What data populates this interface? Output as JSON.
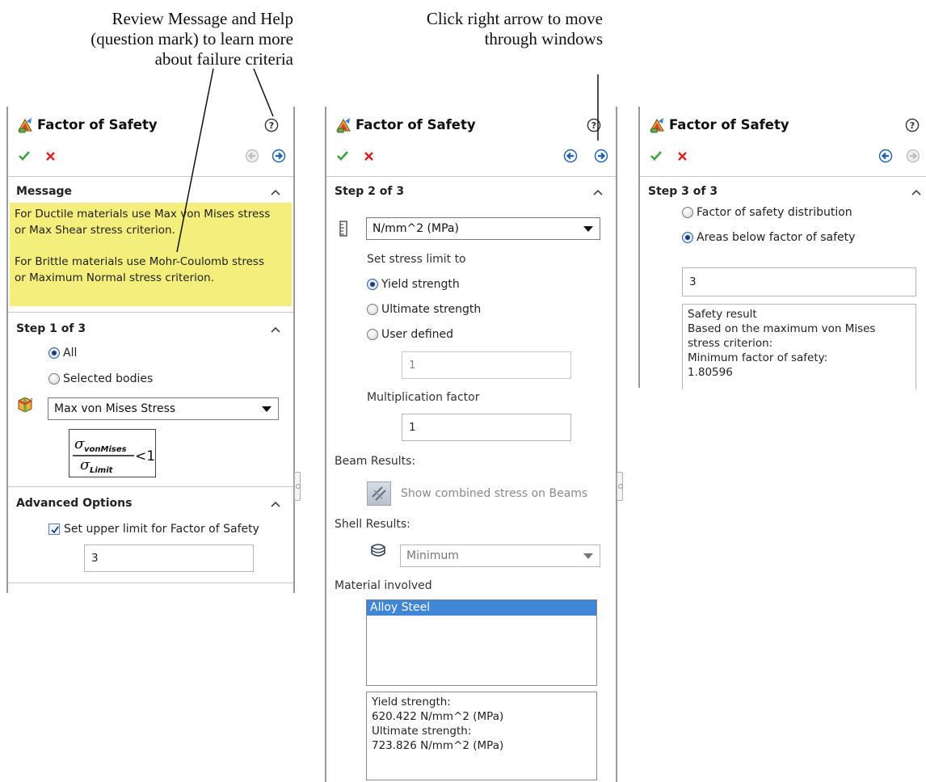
{
  "callouts": {
    "help": [
      "Review Message and Help",
      "(question mark) to learn more",
      "about failure criteria"
    ],
    "arrow": [
      "Click right arrow to move",
      "through windows"
    ]
  },
  "panels": [
    {
      "title": "Factor of Safety",
      "icons": [
        "factor-of-safety-icon",
        "help-icon",
        "ok-checkmark-icon",
        "cancel-x-icon",
        "previous-arrow-icon",
        "next-arrow-icon"
      ],
      "message": {
        "title": "Message",
        "paragraphs": [
          [
            "For Ductile materials use Max von Mises stress",
            "or Max Shear stress criterion."
          ],
          [
            "For Brittle materials use Mohr-Coulomb stress",
            "or Maximum Normal stress criterion."
          ]
        ]
      },
      "step": {
        "title": "Step 1 of 3",
        "radio_all": "All",
        "radio_selected": "Selected bodies",
        "criterion": "Max von Mises Stress",
        "formula": {
          "numerator": "σ",
          "numerator_sub": "vonMises",
          "denominator": "σ",
          "denominator_sub": "Limit",
          "relation": "<1"
        }
      },
      "advanced": {
        "title": "Advanced Options",
        "checkbox_label": "Set upper limit for Factor of Safety",
        "checked": true,
        "value": "3"
      }
    },
    {
      "title": "Factor of Safety",
      "step": {
        "title": "Step 2 of 3",
        "units": "N/mm^2 (MPa)",
        "limit_label": "Set stress limit to",
        "options": [
          "Yield strength",
          "Ultimate strength",
          "User defined"
        ],
        "selected": "Yield strength",
        "user_value": "1",
        "mult_label": "Multiplication factor",
        "mult_value": "1",
        "beam_label": "Beam Results:",
        "beam_button": "Show combined stress on Beams",
        "shell_label": "Shell Results:",
        "shell_value": "Minimum",
        "material_label": "Material involved",
        "materials": [
          "Alloy Steel"
        ],
        "props": [
          "Yield strength:",
          "620.422 N/mm^2 (MPa)",
          "Ultimate strength:",
          "723.826 N/mm^2 (MPa)"
        ]
      }
    },
    {
      "title": "Factor of Safety",
      "step": {
        "title": "Step 3 of 3",
        "options": [
          "Factor of safety distribution",
          "Areas below factor of safety"
        ],
        "selected": "Areas below factor of safety",
        "value": "3",
        "result_lines": [
          "Safety result",
          "Based on the maximum von Mises",
          "stress criterion:",
          "Minimum factor of safety:",
          "1.80596"
        ]
      }
    }
  ],
  "colors": {
    "message_bg": "#f4ee7c",
    "ok_green": "#3aa33a",
    "cancel_red": "#d62020",
    "nav_blue": "#1f5fae",
    "selection_blue": "#3f86d6"
  }
}
